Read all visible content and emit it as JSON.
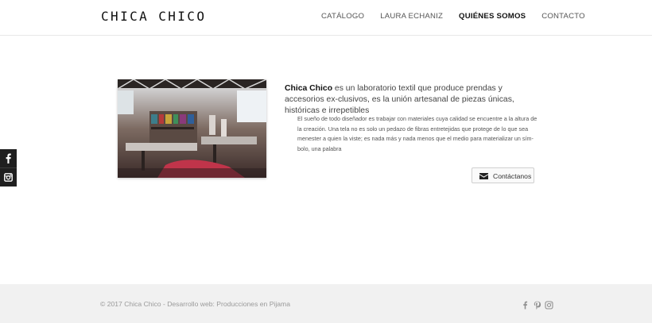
{
  "header": {
    "logo": "CHICA CHICO",
    "nav": [
      {
        "label": "CATÁLOGO"
      },
      {
        "label": "LAURA ECHANIZ"
      },
      {
        "label": "QUIÉNES SOMOS",
        "active": true
      },
      {
        "label": "CONTACTO"
      }
    ]
  },
  "side_social": [
    "facebook-icon",
    "instagram-icon"
  ],
  "main": {
    "lead_brand": "Chica Chico",
    "lead_rest": " es un laboratorio textil que produce prendas y accesorios ex-clusivos, es la unión artesanal de piezas únicas, históricas e irrepetibles",
    "body": "El sueño de todo diseñador es trabajar con materiales cuya calidad se encuentre a la altura de la creación. Una tela no es solo un pedazo de fibras entretejidas que protege de lo que sea menester a quien la viste; es nada más y nada menos que el medio para materializar un sím-bolo, una palabra",
    "contact_button": "Contáctanos",
    "photo_alt": "Taller textil"
  },
  "footer": {
    "copyright": "© 2017 Chica Chico - Desarrollo web: ",
    "credit": "Producciones en Pijama",
    "icons": [
      "facebook-icon",
      "pinterest-icon",
      "instagram-icon"
    ]
  },
  "colors": {
    "footer_bg": "#f1f1f1",
    "side_bar_bg": "#1f1f1f",
    "text_dark": "#111111"
  }
}
